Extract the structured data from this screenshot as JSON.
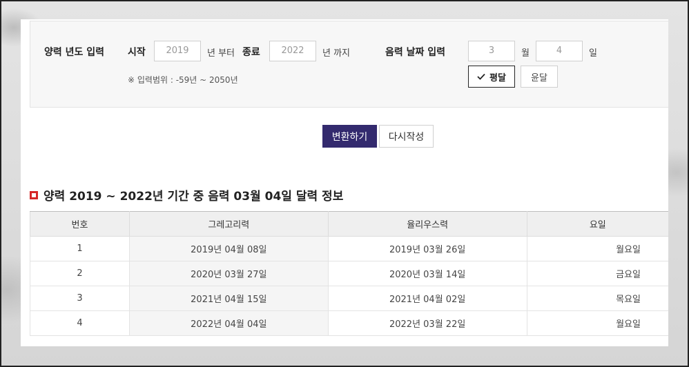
{
  "form": {
    "solar_year_label": "양력 년도 입력",
    "start_label": "시작",
    "start_year": "2019",
    "from_suffix": "년 부터",
    "end_label": "종료",
    "end_year": "2022",
    "to_suffix": "년 까지",
    "range_note": "※ 입력범위 : -59년 ~ 2050년",
    "lunar_date_label": "음력 날짜 입력",
    "month_value": "3",
    "month_suffix": "월",
    "day_value": "4",
    "day_suffix": "일",
    "normal_month_label": "평달",
    "leap_month_label": "윤달"
  },
  "actions": {
    "convert_label": "변환하기",
    "reset_label": "다시작성"
  },
  "result": {
    "title": "양력 2019 ~ 2022년 기간 중 음력 03월 04일 달력 정보",
    "headers": [
      "번호",
      "그레고리력",
      "율리우스력",
      "요일"
    ],
    "rows": [
      {
        "no": "1",
        "gregorian": "2019년 04월 08일",
        "julian": "2019년 03월 26일",
        "weekday": "월요일"
      },
      {
        "no": "2",
        "gregorian": "2020년 03월 27일",
        "julian": "2020년 03월 14일",
        "weekday": "금요일"
      },
      {
        "no": "3",
        "gregorian": "2021년 04월 15일",
        "julian": "2021년 04월 02일",
        "weekday": "목요일"
      },
      {
        "no": "4",
        "gregorian": "2022년 04월 04일",
        "julian": "2022년 03월 22일",
        "weekday": "월요일"
      }
    ]
  },
  "colors": {
    "primary_button": "#332a6e",
    "bullet": "#d62828"
  }
}
